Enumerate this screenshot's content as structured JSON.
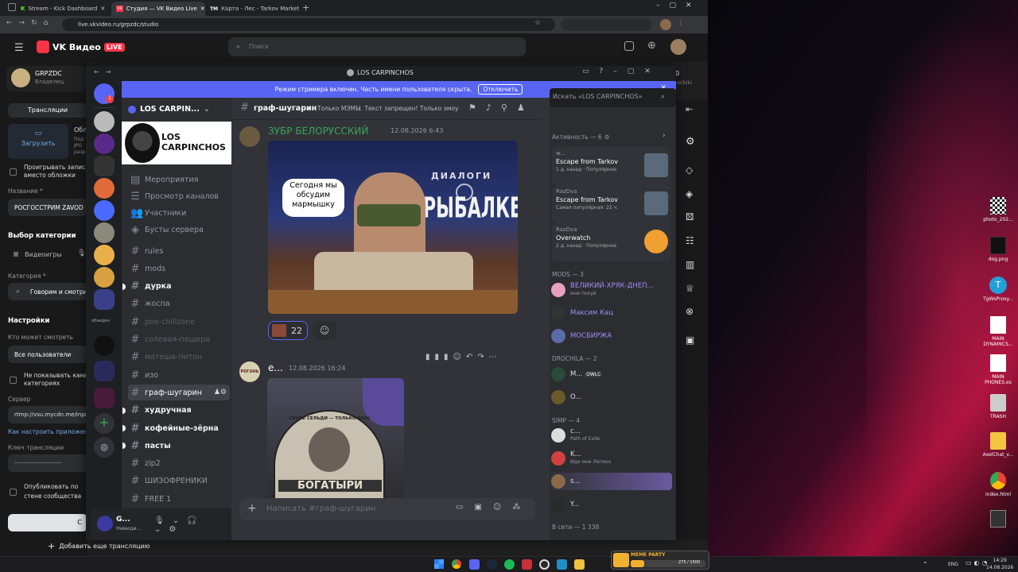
{
  "browser": {
    "tabs": [
      {
        "label": "Stream - Kick Dashboard",
        "icon": "K",
        "color": "#53fc18"
      },
      {
        "label": "Студия — VK Видео Live",
        "icon": "VK",
        "color": "#ff3347"
      },
      {
        "label": "Карта - Лес - Tarkov Market",
        "icon": "TM",
        "color": "#5a5a5a"
      }
    ],
    "url": "live.vkvideo.ru/grpzdc/studio"
  },
  "vk": {
    "logo_text": "VK Видео",
    "live_badge": "LIVE",
    "search_placeholder": "Поиск",
    "channel_name": "GRPZDC",
    "channel_role": "Владелец",
    "tab_broadcasts": "Трансляции",
    "upload_label": "Загрузить",
    "cover_title": "Обл",
    "cover_hint1": "Под",
    "cover_hint2": "JPG",
    "cover_hint3": "разр",
    "play_label": "Проигрывать запис",
    "play_label2": "вместо обложки",
    "name_label": "Название *",
    "name_value": "РОСГОССТРИМ ZAVOD",
    "category_header": "Выбор категории",
    "category_games": "Видеоигры",
    "category_label": "Категория *",
    "category_value": "Говорим и смотри",
    "settings_header": "Настройки",
    "who_can_watch": "Кто может смотреть",
    "who_value": "Все пользователи",
    "hide_cat": "Не показывать кана",
    "hide_cat2": "категориях",
    "server_label": "Сервер",
    "server_value": "rtmp://vsu.mycdn.me/input",
    "howto_link": "Как настроить приложен",
    "key_label": "Ключ трансляции",
    "key_value": "···························",
    "publish_label": "Опубликовать по",
    "publish_label2": "стене сообщества",
    "right_partial": "0",
    "right_partial2": "ochiki",
    "add_stream": "Добавить еще трансляцию",
    "bottom_left_btn": "C"
  },
  "discord": {
    "window_title": "LOS CARPINCHOS",
    "banner_text": "Режим стримера включен. Часть имени пользователя скрыта.",
    "banner_button": "Отключить",
    "server_name": "LOS CARPIN...",
    "server_banner_text": "LOS CARPINCHOS",
    "guild_folder_label": "объедин",
    "nav_items": [
      "Мероприятия",
      "Просмотр каналов",
      "Участники",
      "Бусты сервера"
    ],
    "channels": [
      {
        "name": "rules",
        "state": "normal"
      },
      {
        "name": "mods",
        "state": "normal"
      },
      {
        "name": "дурка",
        "state": "unread"
      },
      {
        "name": "жоспа",
        "state": "normal"
      },
      {
        "name": "poe-chillzone",
        "state": "muted"
      },
      {
        "name": "солевая-пещера",
        "state": "muted"
      },
      {
        "name": "матеша-питон",
        "state": "muted"
      },
      {
        "name": "изо",
        "state": "normal"
      },
      {
        "name": "граф-шугарин",
        "state": "selected"
      },
      {
        "name": "худручная",
        "state": "unread"
      },
      {
        "name": "кофейные-зёрна",
        "state": "unread"
      },
      {
        "name": "пасты",
        "state": "unread"
      },
      {
        "name": "zip2",
        "state": "normal"
      },
      {
        "name": "ШИЗОФРЕНИКИ",
        "state": "normal"
      },
      {
        "name": "FREE 1",
        "state": "normal"
      }
    ],
    "channel_title": "граф-шугарин",
    "channel_topic": "Только МЭМЫ. Текст запрещен! Только эмоу...",
    "search_placeholder": "Искать «LOS CARPINCHOS»",
    "message1": {
      "author": "ЗУБР БЕЛОРУССКИЙ",
      "time": "12.08.2026 6:43",
      "bubble_text": "Сегодня мы обсудим мармышку",
      "tv_title_top": "ДИАЛОГИ",
      "tv_title_big": "РЫБАЛКЕ",
      "reaction_count": "22"
    },
    "message2": {
      "author": "е...",
      "time": "12.08.2026 16:24",
      "avatar_text": "РОГАНЬ",
      "shirt_text_top": "СИНЕЕ СЕЛЬДИ — ТОЛЬКО ВАШ",
      "shirt_text_bottom": "БОГАТЫРИ"
    },
    "composer_placeholder": "Написать #граф-шугарин",
    "user_panel": {
      "name": "G...",
      "status": "Невиди..."
    },
    "members": {
      "activity_header": "Активность — 6",
      "activities": [
        {
          "user": "w...",
          "game": "Escape from Tarkov",
          "meta": "1 д. назад · Популярное"
        },
        {
          "user": "RazDva",
          "game": "Escape from Tarkov",
          "meta": "Самая популярная: 22 ч."
        },
        {
          "user": "RazDva",
          "game": "Overwatch",
          "meta": "2 д. назад · Популярное"
        }
      ],
      "mods_header": "MODS — 3",
      "mods": [
        {
          "name": "ВЕЛИКИЙ-ХРЯК-ДНЕП...",
          "sub": "мне похуй",
          "color": "#a48bf5"
        },
        {
          "name": "Максим Кац",
          "sub": "",
          "color": "#a48bf5"
        },
        {
          "name": "МОСБИРЖА",
          "sub": "",
          "color": "#a48bf5"
        }
      ],
      "drochila_header": "DROCHILA — 2",
      "drochila": [
        {
          "name": "M...",
          "tag": "OWLC"
        },
        {
          "name": "O...",
          "tag": ""
        }
      ],
      "simp_header": "SIMP — 4",
      "simp": [
        {
          "name": "c...",
          "sub": "Path of Exile"
        },
        {
          "name": "K...",
          "sub": "Иди мне Легион"
        },
        {
          "name": "s...",
          "sub": ""
        },
        {
          "name": "Y...",
          "sub": ""
        }
      ],
      "online_header": "В сети — 1 338"
    }
  },
  "desktop_icons": [
    {
      "label": "photo_202...",
      "kind": "qr"
    },
    {
      "label": "dog.png",
      "kind": "dark"
    },
    {
      "label": "TgWsProxy...",
      "kind": "tg"
    },
    {
      "label": "MAIN DYNAMICS...",
      "kind": "doc"
    },
    {
      "label": "MAIN PHONES.es",
      "kind": "doc"
    },
    {
      "label": "TRASH",
      "kind": "bin"
    },
    {
      "label": "AxelChat_v...",
      "kind": "folder"
    },
    {
      "label": "index.html",
      "kind": "chrome"
    },
    {
      "label": "",
      "kind": "device"
    }
  ],
  "taskbar": {
    "widget_title": "МЕМЕ PARTY",
    "widget_count": "275 / 1500",
    "lang": "ENG",
    "time": "14:29",
    "date": "14.08.2026"
  },
  "colors": {
    "discord_accent": "#5865f2",
    "vk_live": "#ff3347",
    "author_green": "#3ba55d"
  }
}
